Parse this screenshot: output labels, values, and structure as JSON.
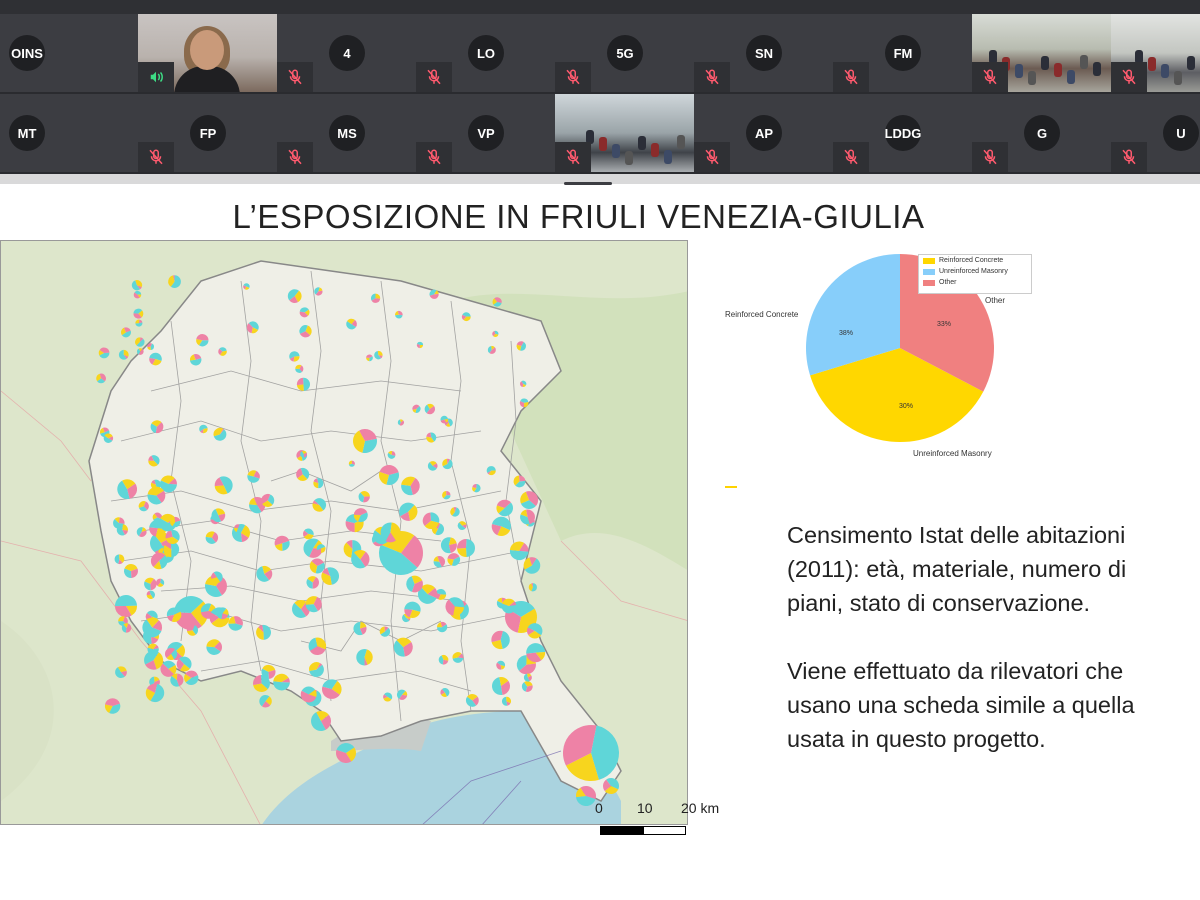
{
  "participants": [
    {
      "initials": "OINS",
      "muted": false,
      "video": false
    },
    {
      "initials": "",
      "muted": false,
      "video": true,
      "speaking": true
    },
    {
      "initials": "4",
      "muted": true,
      "video": false
    },
    {
      "initials": "LO",
      "muted": true,
      "video": false
    },
    {
      "initials": "5G",
      "muted": true,
      "video": false
    },
    {
      "initials": "SN",
      "muted": true,
      "video": false
    },
    {
      "initials": "FM",
      "muted": true,
      "video": false
    },
    {
      "initials": "",
      "muted": true,
      "video": true
    },
    {
      "initials": "",
      "muted": true,
      "video": true
    },
    {
      "initials": "MT",
      "muted": false,
      "video": false
    },
    {
      "initials": "FP",
      "muted": true,
      "video": false
    },
    {
      "initials": "MS",
      "muted": true,
      "video": false
    },
    {
      "initials": "VP",
      "muted": true,
      "video": false
    },
    {
      "initials": "",
      "muted": true,
      "video": true
    },
    {
      "initials": "AP",
      "muted": true,
      "video": false
    },
    {
      "initials": "LDDG",
      "muted": true,
      "video": false
    },
    {
      "initials": "G",
      "muted": true,
      "video": false
    },
    {
      "initials": "U",
      "muted": true,
      "video": false
    }
  ],
  "slide": {
    "title": "L’ESPOSIZIONE IN FRIULI VENEZIA-GIULIA",
    "paragraphs": [
      "Censimento Istat delle abitazioni (2011): età, materiale, numero di piani, stato di conservazione.",
      "Viene effettuato da rilevatori che usano una scheda simile a quella usata in questo progetto."
    ],
    "scale_labels": [
      "0",
      "10",
      "20 km"
    ]
  },
  "chart_data": {
    "type": "pie",
    "categories": [
      "Reinforced Concrete",
      "Unreinforced Masonry",
      "Other"
    ],
    "values": [
      38,
      30,
      33
    ],
    "value_labels": [
      "38%",
      "30%",
      "33%"
    ],
    "colors": [
      "#ffd700",
      "#87cefa",
      "#f08080"
    ],
    "legend_position": "upper-right"
  },
  "colors": {
    "tile_bg": "#3c3d42",
    "muted_icon": "#ff5a6e",
    "speaking_icon": "#3ddc84",
    "map_land": "#e7ecd9",
    "map_sea": "#aad3df",
    "pie_cyan": "#5fd6d8",
    "pie_yellow": "#f7d51e",
    "pie_pink": "#ee82a6"
  }
}
